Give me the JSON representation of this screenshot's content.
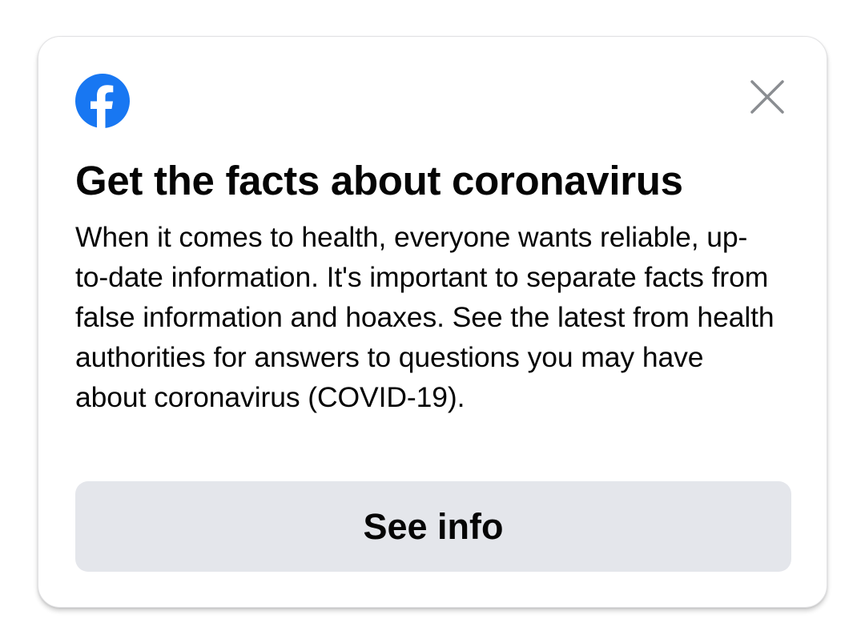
{
  "dialog": {
    "title": "Get the facts about coronavirus",
    "body": "When it comes to health, everyone wants reliable, up-to-date information. It's important to separate facts from false information and hoaxes. See the latest from health authorities for answers to questions you may have about coronavirus (COVID-19).",
    "cta_label": "See info",
    "logo_icon": "facebook-logo-icon",
    "close_icon": "close-icon"
  },
  "colors": {
    "brand_blue": "#1877f2",
    "button_bg": "#e4e6eb",
    "text": "#050505",
    "close_icon": "#8a8d91"
  }
}
